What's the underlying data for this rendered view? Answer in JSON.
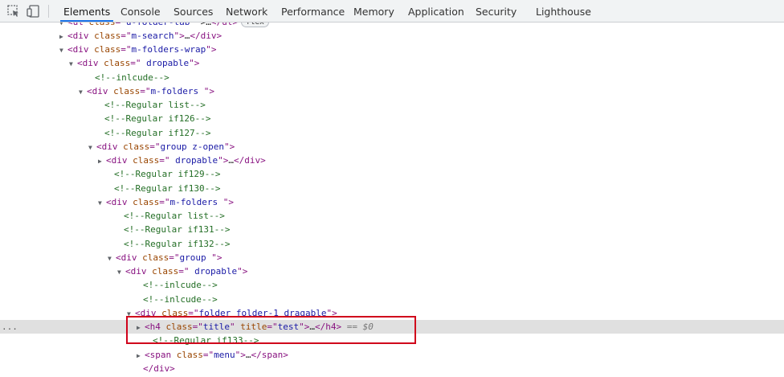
{
  "toolbar": {
    "tabs": [
      {
        "label": "Elements",
        "active": true
      },
      {
        "label": "Console"
      },
      {
        "label": "Sources"
      },
      {
        "label": "Network"
      },
      {
        "label": "Performance"
      },
      {
        "label": "Memory"
      },
      {
        "label": "Application"
      },
      {
        "label": "Security"
      },
      {
        "label": "Lighthouse"
      }
    ],
    "icons": [
      "inspect-element-icon",
      "device-toolbar-icon"
    ]
  },
  "tree": {
    "rows": [
      {
        "tri": "▼",
        "parts": [
          [
            "tag",
            "<ul "
          ],
          [
            "attr",
            "class"
          ],
          [
            "tag",
            "=\""
          ],
          [
            "val",
            "u-folder-tab"
          ],
          [
            "tag",
            "\" "
          ],
          [
            "plain",
            ">…"
          ],
          [
            "tag",
            "</ul>"
          ]
        ],
        "badge": "flex"
      },
      {
        "tri": "▶",
        "parts": [
          [
            "tag",
            "<div "
          ],
          [
            "attr",
            "class"
          ],
          [
            "tag",
            "=\""
          ],
          [
            "val",
            "m-search"
          ],
          [
            "tag",
            "\">"
          ],
          [
            "plain",
            "…"
          ],
          [
            "tag",
            "</div>"
          ]
        ]
      },
      {
        "tri": "▼",
        "parts": [
          [
            "tag",
            "<div "
          ],
          [
            "attr",
            "class"
          ],
          [
            "tag",
            "=\""
          ],
          [
            "val",
            "m-folders-wrap"
          ],
          [
            "tag",
            "\">"
          ]
        ]
      },
      {
        "tri": "▼",
        "parts": [
          [
            "tag",
            "<div "
          ],
          [
            "attr",
            "class"
          ],
          [
            "tag",
            "=\""
          ],
          [
            "val",
            " dropable"
          ],
          [
            "tag",
            "\">"
          ]
        ]
      },
      {
        "tri": "",
        "parts": [
          [
            "comment",
            "<!--inlcude-->"
          ]
        ]
      },
      {
        "tri": "▼",
        "parts": [
          [
            "tag",
            "<div "
          ],
          [
            "attr",
            "class"
          ],
          [
            "tag",
            "=\""
          ],
          [
            "val",
            "m-folders "
          ],
          [
            "tag",
            "\">"
          ]
        ]
      },
      {
        "tri": "",
        "parts": [
          [
            "comment",
            "<!--Regular list-->"
          ]
        ]
      },
      {
        "tri": "",
        "parts": [
          [
            "comment",
            "<!--Regular if126-->"
          ]
        ]
      },
      {
        "tri": "",
        "parts": [
          [
            "comment",
            "<!--Regular if127-->"
          ]
        ]
      },
      {
        "tri": "▼",
        "parts": [
          [
            "tag",
            "<div "
          ],
          [
            "attr",
            "class"
          ],
          [
            "tag",
            "=\""
          ],
          [
            "val",
            "group z-open"
          ],
          [
            "tag",
            "\">"
          ]
        ]
      },
      {
        "tri": "▶",
        "parts": [
          [
            "tag",
            "<div "
          ],
          [
            "attr",
            "class"
          ],
          [
            "tag",
            "=\""
          ],
          [
            "val",
            " dropable"
          ],
          [
            "tag",
            "\">"
          ],
          [
            "plain",
            "…"
          ],
          [
            "tag",
            "</div>"
          ]
        ]
      },
      {
        "tri": "",
        "parts": [
          [
            "comment",
            "<!--Regular if129-->"
          ]
        ]
      },
      {
        "tri": "",
        "parts": [
          [
            "comment",
            "<!--Regular if130-->"
          ]
        ]
      },
      {
        "tri": "▼",
        "parts": [
          [
            "tag",
            "<div "
          ],
          [
            "attr",
            "class"
          ],
          [
            "tag",
            "=\""
          ],
          [
            "val",
            "m-folders "
          ],
          [
            "tag",
            "\">"
          ]
        ]
      },
      {
        "tri": "",
        "parts": [
          [
            "comment",
            "<!--Regular list-->"
          ]
        ]
      },
      {
        "tri": "",
        "parts": [
          [
            "comment",
            "<!--Regular if131-->"
          ]
        ]
      },
      {
        "tri": "",
        "parts": [
          [
            "comment",
            "<!--Regular if132-->"
          ]
        ]
      },
      {
        "tri": "▼",
        "parts": [
          [
            "tag",
            "<div "
          ],
          [
            "attr",
            "class"
          ],
          [
            "tag",
            "=\""
          ],
          [
            "val",
            "group "
          ],
          [
            "tag",
            "\">"
          ]
        ]
      },
      {
        "tri": "▼",
        "parts": [
          [
            "tag",
            "<div "
          ],
          [
            "attr",
            "class"
          ],
          [
            "tag",
            "=\""
          ],
          [
            "val",
            " dropable"
          ],
          [
            "tag",
            "\">"
          ]
        ]
      },
      {
        "tri": "",
        "parts": [
          [
            "comment",
            "<!--inlcude-->"
          ]
        ]
      },
      {
        "tri": "",
        "parts": [
          [
            "comment",
            "<!--inlcude-->"
          ]
        ]
      },
      {
        "tri": "▼",
        "parts": [
          [
            "tag",
            "<div "
          ],
          [
            "attr",
            "class"
          ],
          [
            "tag",
            "=\""
          ],
          [
            "val",
            "folder folder-1 dragable"
          ],
          [
            "tag",
            "\">"
          ]
        ]
      },
      {
        "tri": "▶",
        "parts": [
          [
            "tag",
            "<h4 "
          ],
          [
            "attr",
            "class"
          ],
          [
            "tag",
            "=\""
          ],
          [
            "val",
            "title"
          ],
          [
            "tag",
            "\" "
          ],
          [
            "attr",
            "title"
          ],
          [
            "tag",
            "=\""
          ],
          [
            "val",
            "test"
          ],
          [
            "tag",
            "\">"
          ],
          [
            "plain",
            "…"
          ],
          [
            "tag",
            "</h4>"
          ],
          [
            "dim",
            " == $0"
          ]
        ],
        "selected": true,
        "dots": "..."
      },
      {
        "tri": "",
        "parts": [
          [
            "comment",
            "<!--Regular if133-->"
          ]
        ]
      },
      {
        "tri": "▶",
        "parts": [
          [
            "tag",
            "<span "
          ],
          [
            "attr",
            "class"
          ],
          [
            "tag",
            "=\""
          ],
          [
            "val",
            "menu"
          ],
          [
            "tag",
            "\">"
          ],
          [
            "plain",
            "…"
          ],
          [
            "tag",
            "</span>"
          ]
        ]
      },
      {
        "tri": "",
        "parts": [
          [
            "tag",
            "</div>"
          ]
        ]
      }
    ]
  }
}
